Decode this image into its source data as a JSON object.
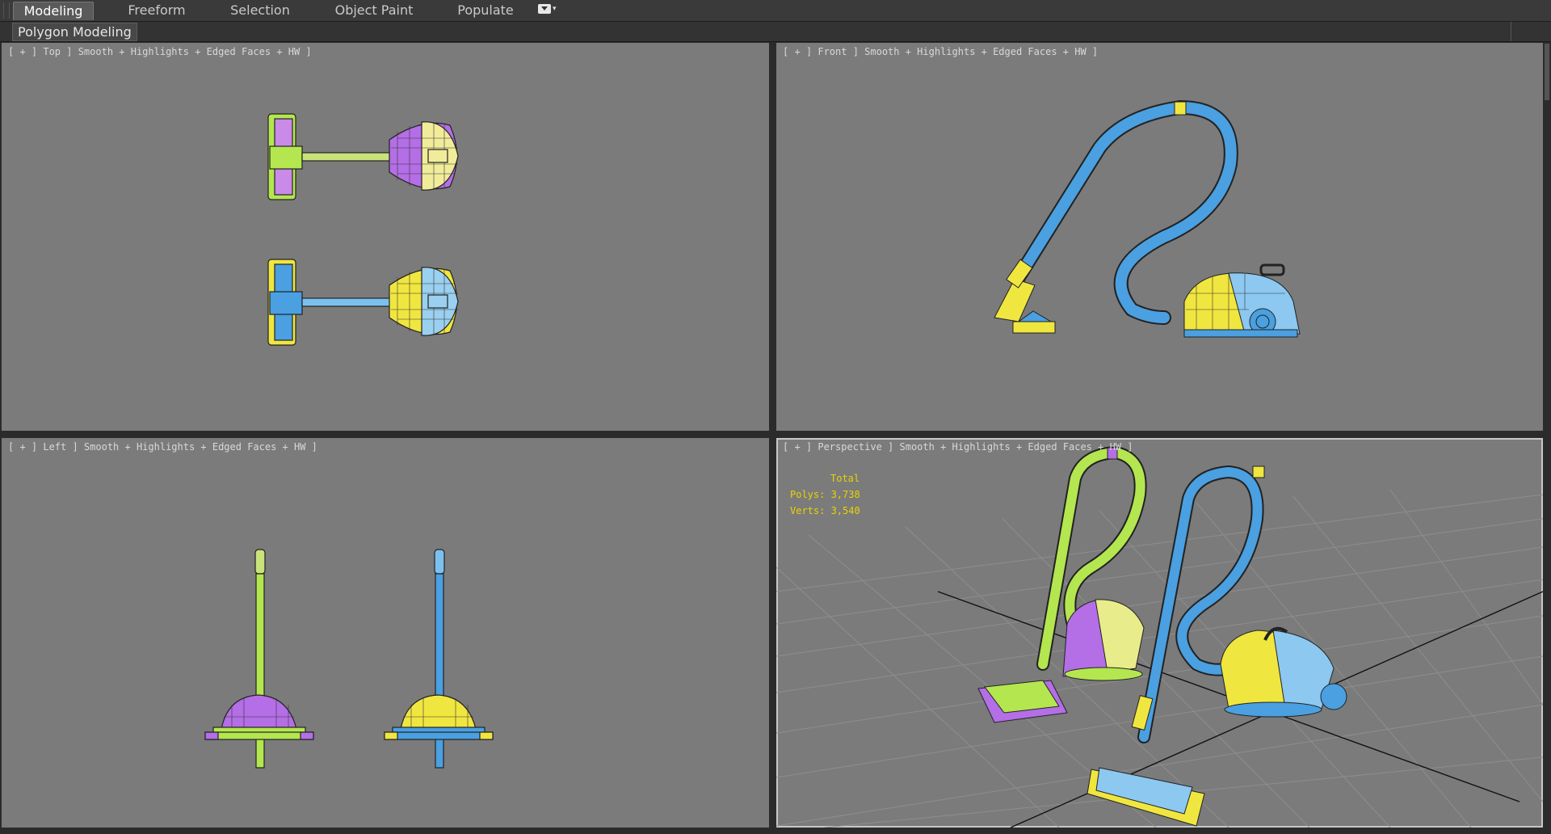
{
  "ribbon": {
    "tabs": [
      {
        "label": "Modeling",
        "active": true
      },
      {
        "label": "Freeform",
        "active": false
      },
      {
        "label": "Selection",
        "active": false
      },
      {
        "label": "Object Paint",
        "active": false
      },
      {
        "label": "Populate",
        "active": false
      }
    ],
    "dropdown_icon": "ribbon-options-icon",
    "panel_label": "Polygon Modeling"
  },
  "viewports": {
    "top": {
      "label": "[ + ] Top ] Smooth + Highlights + Edged Faces + HW ]"
    },
    "front": {
      "label": "[ + ] Front ] Smooth + Highlights + Edged Faces + HW ]"
    },
    "left": {
      "label": "[ + ] Left ] Smooth + Highlights + Edged Faces + HW ]"
    },
    "perspective": {
      "label": "[ + ] Perspective ] Smooth + Highlights + Edged Faces + HW ]",
      "stats": {
        "title": "Total",
        "polys": "Polys: 3,738",
        "verts": "Verts: 3,540"
      }
    }
  },
  "colors": {
    "viewport_bg": "#7b7b7b",
    "model_blue": "#4aa0e0",
    "model_yellow": "#f0e640",
    "model_purple": "#b46ee6",
    "model_lime": "#b4e650",
    "stats_text": "#e8d400"
  }
}
